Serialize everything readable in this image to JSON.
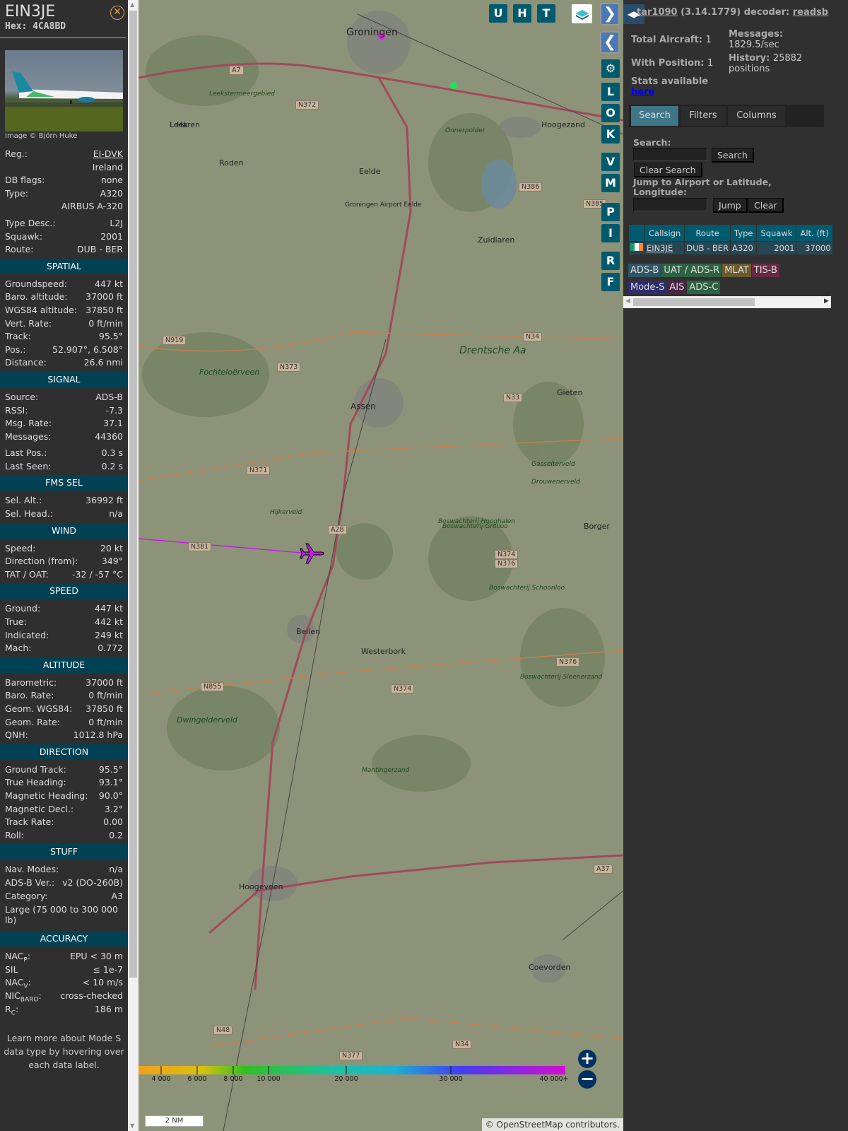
{
  "aircraft": {
    "callsign": "EIN3JE",
    "hex_label": "Hex:",
    "hex": "4CA8BD",
    "photo_credit": "Image © Björn Huke"
  },
  "details": [
    {
      "l": "Reg.:",
      "v": "EI-DVK",
      "link": true
    },
    {
      "l": "",
      "v": "Ireland"
    },
    {
      "l": "DB flags:",
      "v": "none"
    },
    {
      "l": "Type:",
      "v": "A320"
    },
    {
      "l": "",
      "v": "AIRBUS A-320"
    },
    {
      "gap": true
    },
    {
      "l": "Type Desc.:",
      "v": "L2J"
    },
    {
      "l": "Squawk:",
      "v": "2001"
    },
    {
      "l": "Route:",
      "v": "DUB - BER"
    },
    {
      "sec": "SPATIAL"
    },
    {
      "l": "Groundspeed:",
      "v": "447 kt"
    },
    {
      "l": "Baro. altitude:",
      "v": "37000 ft"
    },
    {
      "l": "WGS84 altitude:",
      "v": "37850 ft"
    },
    {
      "l": "Vert. Rate:",
      "v": "0 ft/min"
    },
    {
      "l": "Track:",
      "v": "95.5°"
    },
    {
      "l": "Pos.:",
      "v": "52.907°, 6.508°"
    },
    {
      "l": "Distance:",
      "v": "26.6 nmi"
    },
    {
      "sec": "SIGNAL"
    },
    {
      "l": "Source:",
      "v": "ADS-B"
    },
    {
      "l": "RSSI:",
      "v": "-7.3"
    },
    {
      "l": "Msg. Rate:",
      "v": "37.1"
    },
    {
      "l": "Messages:",
      "v": "44360"
    },
    {
      "gap": true
    },
    {
      "l": "Last Pos.:",
      "v": "0.3 s"
    },
    {
      "l": "Last Seen:",
      "v": "0.2 s"
    },
    {
      "sec": "FMS SEL"
    },
    {
      "l": "Sel. Alt.:",
      "v": "36992 ft"
    },
    {
      "l": "Sel. Head.:",
      "v": "n/a"
    },
    {
      "sec": "WIND"
    },
    {
      "l": "Speed:",
      "v": "20 kt"
    },
    {
      "l": "Direction (from):",
      "v": "349°"
    },
    {
      "l": "TAT / OAT:",
      "v": "-32 / -57 °C"
    },
    {
      "sec": "SPEED"
    },
    {
      "l": "Ground:",
      "v": "447 kt"
    },
    {
      "l": "True:",
      "v": "442 kt"
    },
    {
      "l": "Indicated:",
      "v": "249 kt"
    },
    {
      "l": "Mach:",
      "v": "0.772"
    },
    {
      "sec": "ALTITUDE"
    },
    {
      "l": "Barometric:",
      "v": "37000 ft"
    },
    {
      "l": "Baro. Rate:",
      "v": "0 ft/min"
    },
    {
      "l": "Geom. WGS84:",
      "v": "37850 ft"
    },
    {
      "l": "Geom. Rate:",
      "v": "0 ft/min"
    },
    {
      "l": "QNH:",
      "v": "1012.8 hPa"
    },
    {
      "sec": "DIRECTION"
    },
    {
      "l": "Ground Track:",
      "v": "95.5°"
    },
    {
      "l": "True Heading:",
      "v": "93.1°"
    },
    {
      "l": "Magnetic Heading:",
      "v": "90.0°"
    },
    {
      "l": "Magnetic Decl.:",
      "v": "3.2°"
    },
    {
      "l": "Track Rate:",
      "v": "0.00"
    },
    {
      "l": "Roll:",
      "v": "0.2"
    },
    {
      "sec": "STUFF"
    },
    {
      "l": "Nav. Modes:",
      "v": "n/a"
    },
    {
      "l": "ADS-B Ver.:",
      "v": "v2 (DO-260B)"
    },
    {
      "l": "Category:",
      "v": "A3"
    },
    {
      "full": "Large (75 000 to 300 000 lb)"
    },
    {
      "sec": "ACCURACY"
    },
    {
      "l": "NAC",
      "sub": "P",
      "v": "EPU < 30 m"
    },
    {
      "l": "SIL",
      "v": "≤ 1e-7"
    },
    {
      "l": "NAC",
      "sub": "V",
      "v": "< 10 m/s"
    },
    {
      "l": "NIC",
      "sub": "BARO",
      "v": "cross-checked"
    },
    {
      "l": "R",
      "sub": "C",
      "v": "186 m"
    }
  ],
  "footer": "Learn more about Mode S data type by hovering over each data label.",
  "map": {
    "top_buttons": [
      "U",
      "H",
      "T"
    ],
    "side_buttons": [
      "L",
      "O",
      "K",
      "V",
      "M",
      "P",
      "I",
      "R",
      "F"
    ],
    "icons": {
      "layers": "layers-icon",
      "settings": "gear-icon",
      "next": "chevron-right-icon",
      "prev": "chevron-left-icon",
      "zoom_in": "plus-icon",
      "zoom_out": "minus-icon",
      "aircraft": "airplane-icon"
    },
    "places": [
      "Groningen",
      "Haren",
      "Hoogezand",
      "Leek",
      "Roden",
      "Eelde",
      "Groningen Airport Eelde",
      "Zuidlaren",
      "Leekstermeergebied",
      "Onnerpolder",
      "Drentsche Aa",
      "Assen",
      "Gieten",
      "Fochteloërveen",
      "Gasselterveld",
      "Drouwenerveld",
      "Hijkerveld",
      "Boswachterij Hooghalen",
      "Boswachterij Grolloo",
      "Boswachterij Schoonloo",
      "Borger",
      "Beilen",
      "Westerbork",
      "Boswachterij Sleenerzand",
      "Dwingelderveld",
      "Mantingerzand",
      "Hoogeveen",
      "Coevorden"
    ],
    "roads": [
      "A7",
      "N372",
      "N386",
      "N385",
      "N919",
      "N373",
      "N34",
      "N33",
      "N371",
      "A28",
      "N381",
      "N374",
      "N376",
      "N855",
      "N374",
      "N376",
      "A37",
      "N48",
      "N377",
      "N34"
    ],
    "altitude_scale": [
      "4 000",
      "6 000",
      "8 000",
      "10 000",
      "20 000",
      "30 000",
      "40 000+"
    ],
    "scale_bar": "2 NM",
    "attribution_prefix": "©",
    "attribution_link": "OpenStreetMap",
    "attribution_suffix": "contributors."
  },
  "right": {
    "app": "tar1090",
    "version": "(3.14.1779)",
    "decoder_label": "decoder:",
    "decoder": "readsb",
    "total_label": "Total Aircraft:",
    "total": "1",
    "withpos_label": "With Position:",
    "withpos": "1",
    "messages_label": "Messages:",
    "messages": "1829.5/sec",
    "history_label": "History:",
    "history": "25882 positions",
    "stats_label": "Stats available",
    "stats_link": "here",
    "tabs": [
      "Search",
      "Filters",
      "Columns"
    ],
    "search_label": "Search:",
    "search_value": "",
    "search_button": "Search",
    "clear_search": "Clear Search",
    "jump_label": "Jump to Airport or Latitude, Longitude:",
    "jump_value": "",
    "jump_button": "Jump",
    "clear_button": "Clear",
    "table": {
      "headers": [
        "",
        "Callsign",
        "Route",
        "Type",
        "Squawk",
        "Alt. (ft)"
      ],
      "rows": [
        {
          "flag": "Ireland",
          "callsign": "EIN3JE",
          "route": "DUB - BER",
          "type": "A320",
          "squawk": "2001",
          "alt": "37000"
        }
      ]
    },
    "badges": [
      {
        "t": "ADS-B",
        "c": "#2f5566"
      },
      {
        "t": "UAT / ADS-R",
        "c": "#2d6242"
      },
      {
        "t": "MLAT",
        "c": "#6a5a2e"
      },
      {
        "t": "TIS-B",
        "c": "#6a2a44"
      },
      {
        "t": "Mode-S",
        "c": "#2e2e6e"
      },
      {
        "t": "AIS",
        "c": "#4a2545"
      },
      {
        "t": "ADS-C",
        "c": "#2d6242"
      }
    ]
  }
}
